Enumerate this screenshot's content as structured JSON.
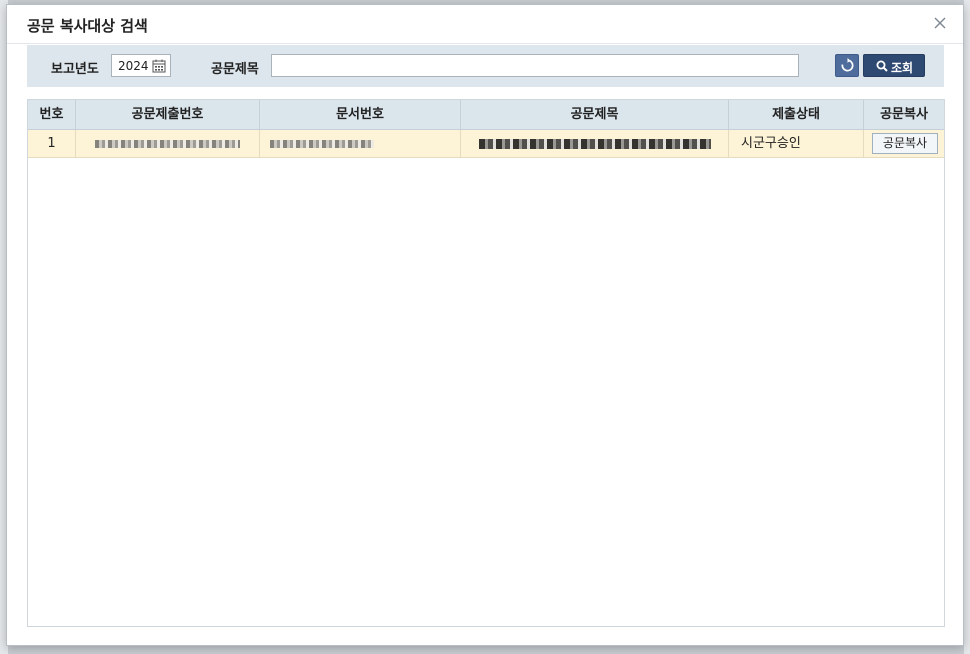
{
  "modal": {
    "title": "공문 복사대상 검색"
  },
  "search": {
    "year_label": "보고년도",
    "year_value": "2024",
    "title_label": "공문제목",
    "title_value": "",
    "search_label": "조회"
  },
  "grid": {
    "columns": [
      "번호",
      "공문제출번호",
      "문서번호",
      "공문제목",
      "제출상태",
      "공문복사"
    ],
    "rows": [
      {
        "no": "1",
        "submit_no": "",
        "doc_no": "",
        "title": "",
        "status": "시군구승인",
        "action": "공문복사"
      }
    ]
  },
  "colors": {
    "header_bg": "#dbe5ec",
    "search_bg": "#dde6ec",
    "row_highlight": "#fdf3d6",
    "primary_button": "#2e4a72"
  },
  "icons": {
    "close": "close-icon",
    "calendar": "calendar-icon",
    "reset": "refresh-icon",
    "search": "search-icon"
  }
}
